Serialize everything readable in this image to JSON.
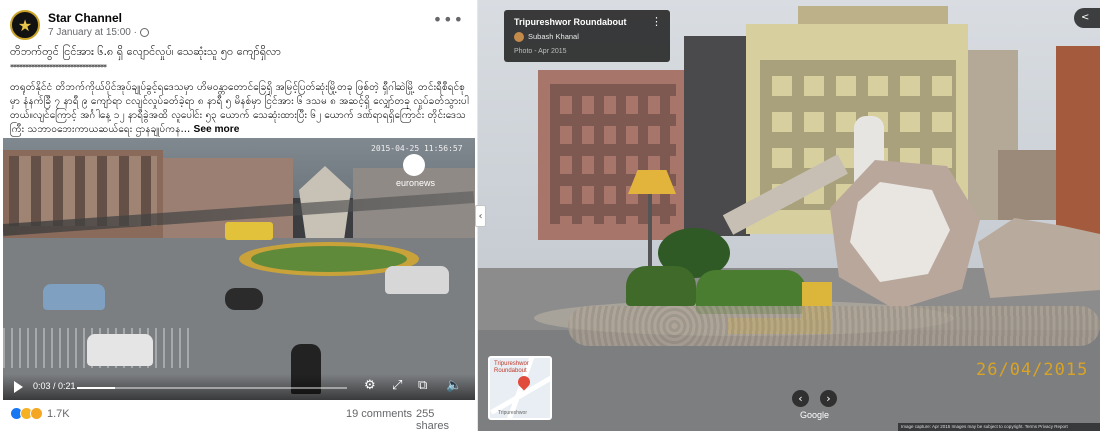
{
  "facebook_post": {
    "page_name": "Star Channel",
    "post_time": "7 January at 15:00 ·",
    "title": "တိဘက်တွင် ငြင်အား ၆.၈ ရှိ လျောင်လှုပ်၊ သေဆုံးသူ ၅၀ ကျော်ရှိလာ",
    "stars": "********************************",
    "body": "တရုတ်နိုင်ငံ တိဘက်ကိုယ်ပိုင်အုပ်ချုပ်ခွင့်ရဒေသမှာ ဟိမဝန္တာတောင်ခြေရှိ အမြင့်ပြတ်ဆုံးမြို့တခု ဖြစ်တဲ့ ရှီဂါဆဲမြို့ တင်းရီစီရင်စုမှာ နံနက်ခြီ ၇ နာရီ ၉ ကျော်ရာ ငလျင်လှုပ်ခတ်ခဲ့ရာ ၈ နာရီ ၅ မိနစ်မှာ ငြင်အား ၆ ဒသမ ၈ အဆင့်ရှိ လျှော်တခု လှုပ်ခတ်သွားပါတယ်။လျင်ကြောင့် အင်္ဂါနေ့ ၁၂ နာရီခွဲအထိ လူပေါင်း ၅၃ ယောက် သေဆုံးထားပြီး ၆၂ ယောက် ဒဏ်ရာရရှိကြောင်း တိုင်းဒေသကြီး သဘာဝဘေးကာယဆယ်ရေး ဌာနချုပ်ကန...",
    "see_more": "See more",
    "reactions_count": "1.7K",
    "comments": "19 comments",
    "shares": "255 shares",
    "more_icon": "•••"
  },
  "video": {
    "timestamp_overlay": "2015-04-25  11:56:57",
    "logo_text": "euronews",
    "time": "0:03 / 0:21",
    "progress": 0.14,
    "controls": [
      "settings-icon",
      "fullscreen-icon",
      "picture-in-picture-icon",
      "volume-icon"
    ]
  },
  "street_view": {
    "title": "Tripureshwor Roundabout",
    "author": "Subash Khanal",
    "photo_date": "Photo - Apr 2015",
    "date_stamp": "26/04/2015",
    "google_label": "Google",
    "map_label": "Tripureshwor Roundabout",
    "map_label2": "Tripureshwor",
    "footer": "Image capture: Apr 2015   Images may be subject to copyright.   Terms   Privacy   Report"
  },
  "colors": {
    "facebook_blue": "#1877f2",
    "date_stamp": "#d8a326"
  }
}
